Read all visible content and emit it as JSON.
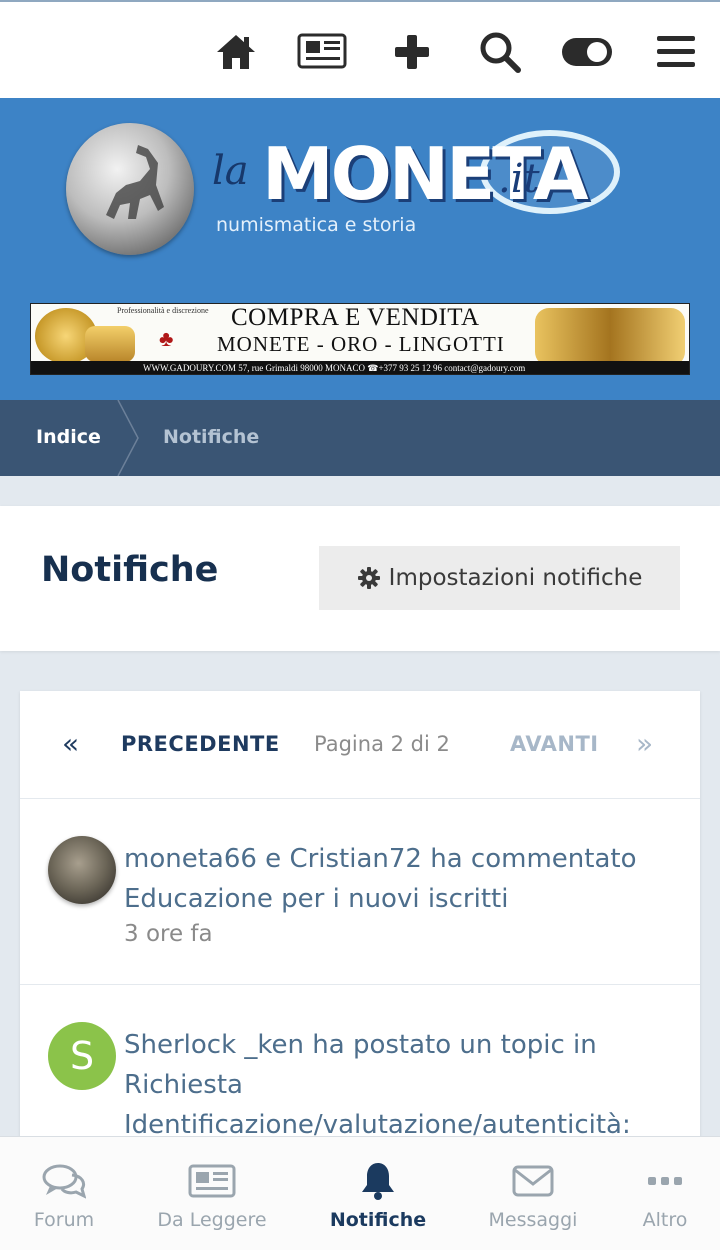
{
  "topbar": {
    "icons": [
      "home-icon",
      "newspaper-icon",
      "plus-icon",
      "search-icon",
      "toggle-icon",
      "menu-icon"
    ]
  },
  "brand": {
    "logo_prefix": "la",
    "logo_main": "MONETA",
    "logo_suffix": ".it",
    "logo_tagline": "numismatica e storia"
  },
  "ad": {
    "tagline": "Professionalità e discrezione",
    "headline": "COMPRA E VENDITA",
    "subheadline": "MONETE - ORO - LINGOTTI",
    "footer": "WWW.GADOURY.COM   57, rue Grimaldi 98000 MONACO   ☎+377 93 25 12 96   contact@gadoury.com"
  },
  "breadcrumb": {
    "items": [
      "Indice",
      "Notifiche"
    ]
  },
  "page": {
    "title": "Notifiche",
    "settings_button": "Impostazioni notifiche"
  },
  "pagination": {
    "first": "«",
    "prev_label": "PRECEDENTE",
    "info": "Pagina 2 di 2",
    "next_label": "AVANTI",
    "last": "»"
  },
  "notifications": [
    {
      "text": "moneta66 e Cristian72 ha commentato Educazione per i nuovi iscritti",
      "time": "3 ore fa",
      "avatar": "coin-avatar"
    },
    {
      "text": "Sherlock _ken ha postato un topic in Richiesta Identificazione/valutazione/autenticità:",
      "avatar_letter": "S",
      "avatar_color": "#8bc34a"
    }
  ],
  "bottom_nav": {
    "items": [
      {
        "label": "Forum",
        "icon": "comments-icon",
        "active": false
      },
      {
        "label": "Da Leggere",
        "icon": "newspaper-icon",
        "active": false
      },
      {
        "label": "Notifiche",
        "icon": "bell-icon",
        "active": true
      },
      {
        "label": "Messaggi",
        "icon": "envelope-icon",
        "active": false
      },
      {
        "label": "Altro",
        "icon": "more-icon",
        "active": false
      }
    ]
  },
  "colors": {
    "brand_blue": "#3d83c6",
    "breadcrumb": "#3a5574",
    "title_navy": "#17304f",
    "link_blue": "#4d6e8c"
  }
}
